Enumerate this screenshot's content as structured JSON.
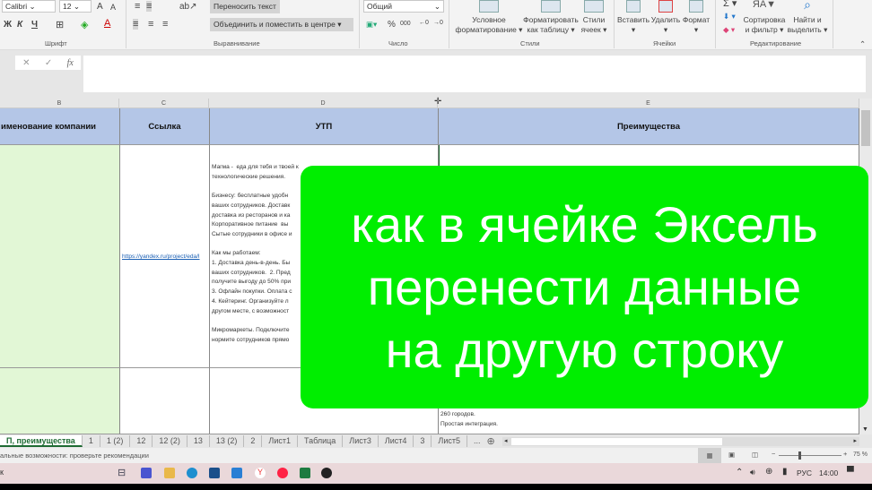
{
  "ribbon": {
    "font_name": "Calibri",
    "font_size": "12",
    "bold": "Ж",
    "italic": "К",
    "underline": "Ч",
    "grow_font": "A",
    "shrink_font": "A",
    "wrap_text": "Переносить текст",
    "merge_center": "Объединить и поместить в центре",
    "number_format": "Общий",
    "percent": "%",
    "thousands": "000",
    "conditional_format": [
      "Условное",
      "форматирование"
    ],
    "format_as_table": [
      "Форматировать",
      "как таблицу"
    ],
    "cell_styles": [
      "Стили",
      "ячеек"
    ],
    "insert": "Вставить",
    "delete": "Удалить",
    "format": "Формат",
    "sort_filter": [
      "Сортировка",
      "и фильтр"
    ],
    "find_select": [
      "Найти и",
      "выделить"
    ],
    "groups": {
      "font": "Шрифт",
      "alignment": "Выравнивание",
      "number": "Число",
      "styles": "Стили",
      "cells": "Ячейки",
      "editing": "Редактирование"
    }
  },
  "formula_bar": {
    "fx": "fx",
    "value": ""
  },
  "columns": [
    "B",
    "C",
    "D",
    "E"
  ],
  "headers": {
    "B": "именование компании",
    "C": "Ссылка",
    "D": "УТП",
    "E": "Преимущества"
  },
  "cells": {
    "C2": "https://yandex.ru/project/eda/l",
    "D2": "Магма -  еда для тебя и твоей к\nтехнологические решения.\n\nБизнесу: бесплатные удобн\nваших сотрудников. Доставк\nдоставка из ресторанов и ка\nКорпоративное питание  вы\nСытые сотрудники в офисе и\n\nКак мы работаем:\n1. Доставка день-в-день. Бы\nваших сотрудников.  2. Пред\nполучите выгоду до 50% при\n3. Офлайн покупки. Оплата с\n4. Кейтеринг. Организуйте л\nдругом месте, с возможност\n\nМикромаркеты. Подключите\nнормите сотрудников прямо",
    "E2": "260 городов.\nПростая интеграция."
  },
  "overlay": {
    "lines": [
      "как в ячейке Эксель",
      "перенести данные",
      "на другую строку"
    ],
    "color": "#00ee00"
  },
  "sheet_tabs": [
    "П, преимущества",
    "1",
    "1 (2)",
    "12",
    "12 (2)",
    "13",
    "13 (2)",
    "2",
    "Лист1",
    "Таблица",
    "Лист3",
    "Лист4",
    "3",
    "Лист5",
    "..."
  ],
  "active_tab": "П, преимущества",
  "status": {
    "message": "альные возможности: проверьте рекомендации",
    "zoom": "75 %"
  },
  "taskbar": {
    "search": "к",
    "lang": "РУС",
    "time": "14:00"
  }
}
